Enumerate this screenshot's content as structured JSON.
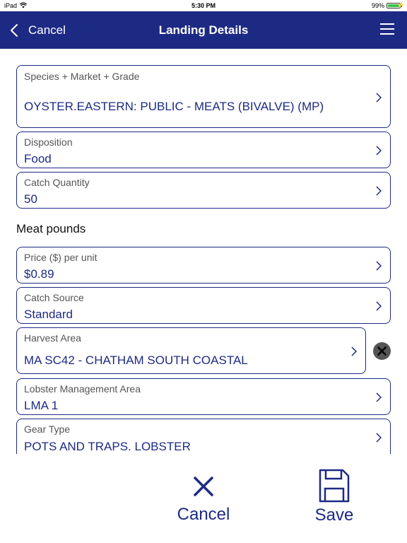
{
  "status": {
    "carrier": "iPad",
    "time": "5:30 PM",
    "battery": "99%",
    "battery_level": 0.99
  },
  "nav": {
    "back_label": "Cancel",
    "title": "Landing Details"
  },
  "fields": {
    "species": {
      "label": "Species + Market + Grade",
      "value": "OYSTER.EASTERN: PUBLIC - MEATS (BIVALVE) (MP)"
    },
    "disposition": {
      "label": "Disposition",
      "value": "Food"
    },
    "catch_quantity": {
      "label": "Catch Quantity",
      "value": "50"
    },
    "unit_label": "Meat pounds",
    "price": {
      "label": "Price ($) per unit",
      "value": "$0.89"
    },
    "catch_source": {
      "label": "Catch Source",
      "value": "Standard"
    },
    "harvest_area": {
      "label": "Harvest Area",
      "value": "MA SC42 - CHATHAM SOUTH COASTAL"
    },
    "lobster_area": {
      "label": "Lobster Management Area",
      "value": "LMA 1"
    },
    "gear_type": {
      "label": "Gear Type",
      "value": "POTS AND TRAPS. LOBSTER"
    }
  },
  "toolbar": {
    "cancel_label": "Cancel",
    "save_label": "Save"
  },
  "colors": {
    "accent": "#1d2a84",
    "nav_bg": "#1d2a84",
    "battery": "#3ac24a"
  },
  "icons": [
    "wifi-icon",
    "battery-icon",
    "back-chevron-icon",
    "menu-icon",
    "chevron-right-icon",
    "clear-icon",
    "close-icon",
    "save-icon"
  ]
}
